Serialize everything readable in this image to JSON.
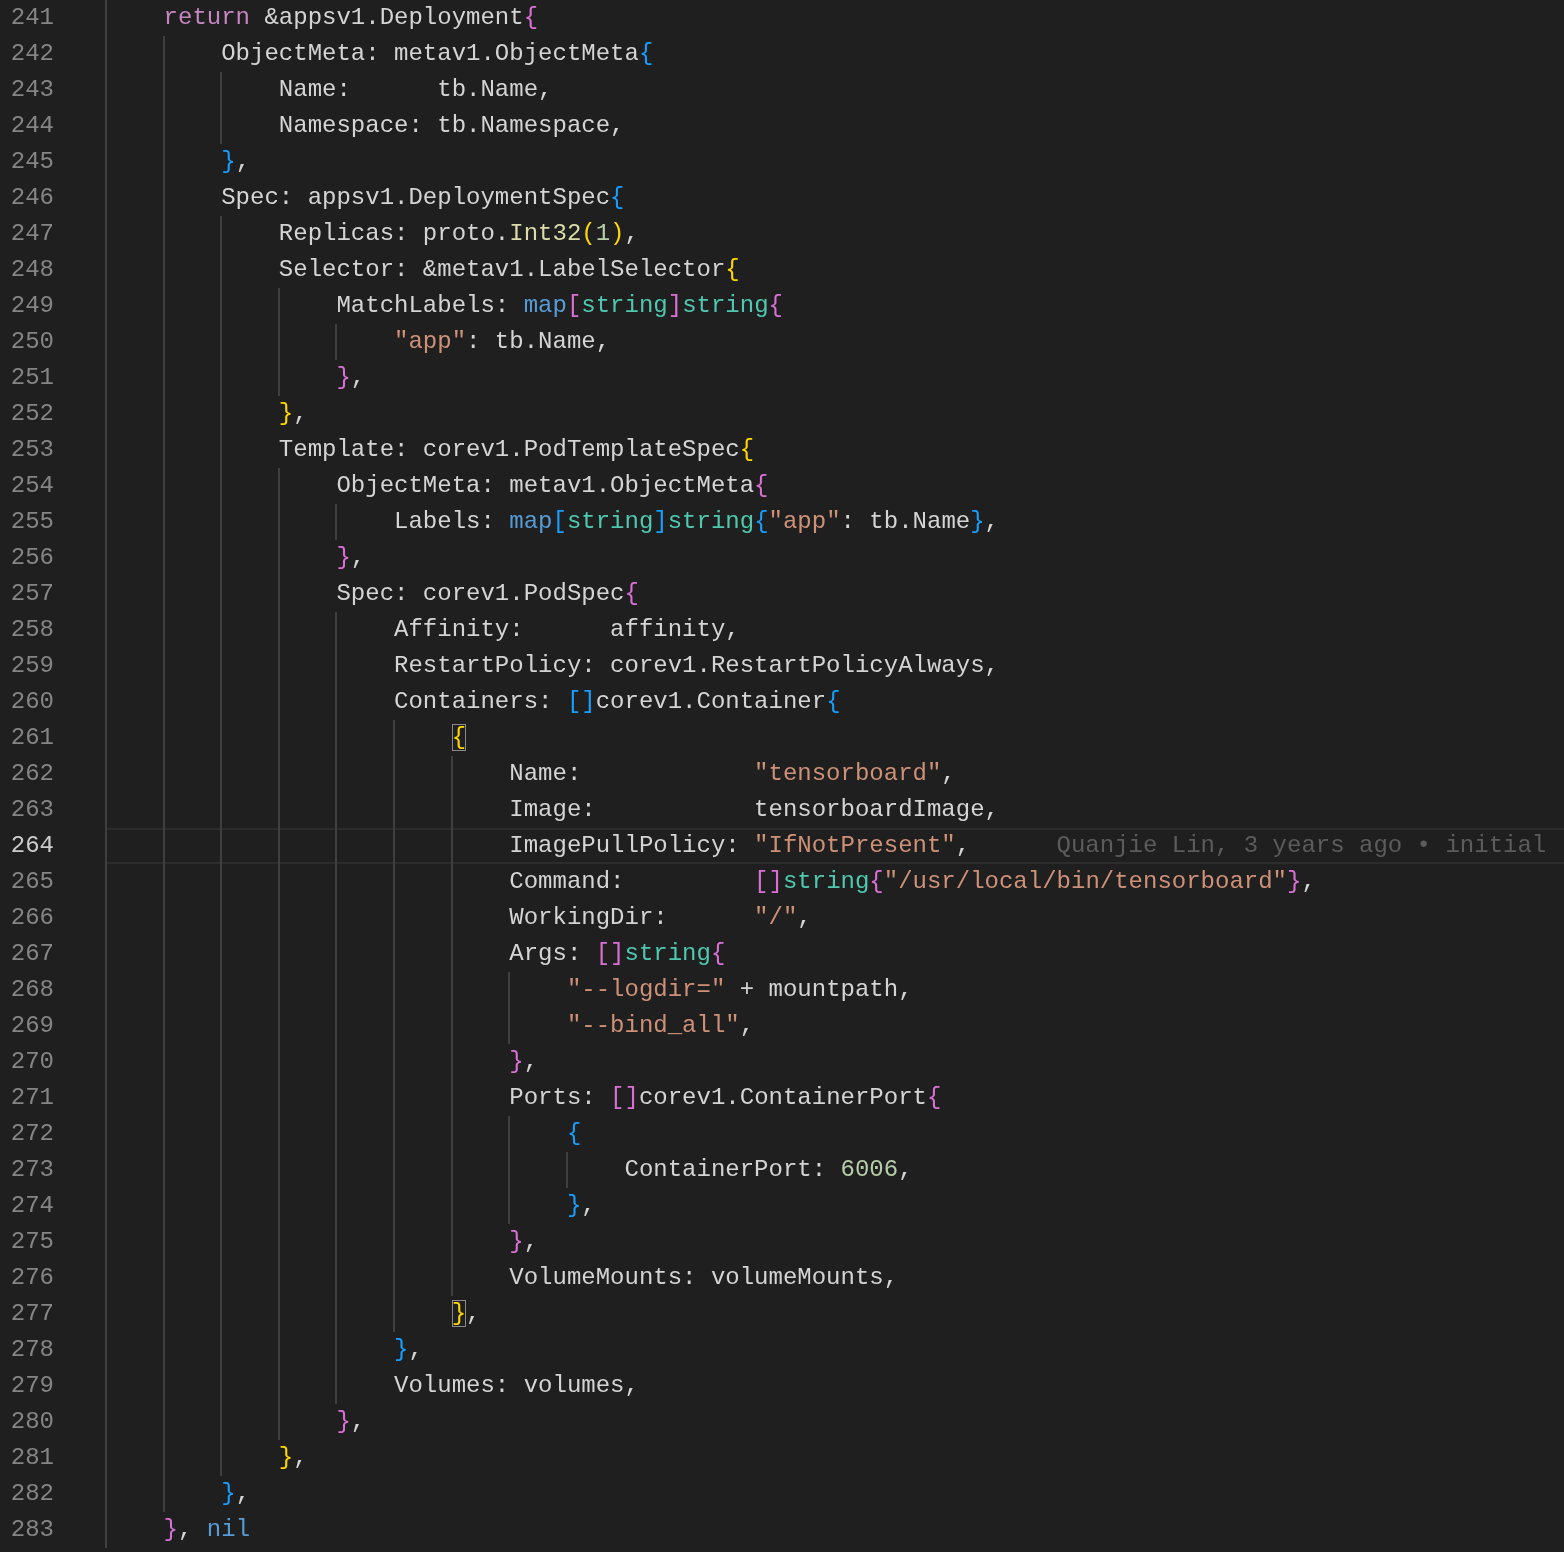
{
  "editor": {
    "lines": [
      {
        "number": "241",
        "current": false,
        "tokens": [
          {
            "kind": "keyword",
            "text": "    return"
          },
          {
            "kind": "plain",
            "text": " &appsv1.Deployment"
          },
          {
            "kind": "bracket",
            "text": "{",
            "color": "#da70d6",
            "matched": false
          }
        ]
      },
      {
        "number": "242",
        "current": false,
        "tokens": [
          {
            "kind": "plain",
            "text": "        ObjectMeta: metav1.ObjectMeta"
          },
          {
            "kind": "bracket",
            "text": "{",
            "color": "#179fff",
            "matched": false
          }
        ]
      },
      {
        "number": "243",
        "current": false,
        "tokens": [
          {
            "kind": "plain",
            "text": "            Name:      tb.Name,"
          }
        ]
      },
      {
        "number": "244",
        "current": false,
        "tokens": [
          {
            "kind": "plain",
            "text": "            Namespace: tb.Namespace,"
          }
        ]
      },
      {
        "number": "245",
        "current": false,
        "tokens": [
          {
            "kind": "bracket",
            "text": "        }",
            "color": "#179fff",
            "matched": false
          },
          {
            "kind": "plain",
            "text": ","
          }
        ]
      },
      {
        "number": "246",
        "current": false,
        "tokens": [
          {
            "kind": "plain",
            "text": "        Spec: appsv1.DeploymentSpec"
          },
          {
            "kind": "bracket",
            "text": "{",
            "color": "#179fff",
            "matched": false
          }
        ]
      },
      {
        "number": "247",
        "current": false,
        "tokens": [
          {
            "kind": "plain",
            "text": "            Replicas: proto."
          },
          {
            "kind": "function",
            "text": "Int32"
          },
          {
            "kind": "bracket",
            "text": "(",
            "color": "#ffd700",
            "matched": false
          },
          {
            "kind": "number",
            "text": "1"
          },
          {
            "kind": "bracket",
            "text": ")",
            "color": "#ffd700",
            "matched": false
          },
          {
            "kind": "plain",
            "text": ","
          }
        ]
      },
      {
        "number": "248",
        "current": false,
        "tokens": [
          {
            "kind": "plain",
            "text": "            Selector: &metav1.LabelSelector"
          },
          {
            "kind": "bracket",
            "text": "{",
            "color": "#ffd700",
            "matched": false
          }
        ]
      },
      {
        "number": "249",
        "current": false,
        "tokens": [
          {
            "kind": "plain",
            "text": "                MatchLabels: "
          },
          {
            "kind": "builtin",
            "text": "map"
          },
          {
            "kind": "bracket",
            "text": "[",
            "color": "#da70d6",
            "matched": false
          },
          {
            "kind": "type",
            "text": "string"
          },
          {
            "kind": "bracket",
            "text": "]",
            "color": "#da70d6",
            "matched": false
          },
          {
            "kind": "type",
            "text": "string"
          },
          {
            "kind": "bracket",
            "text": "{",
            "color": "#da70d6",
            "matched": false
          }
        ]
      },
      {
        "number": "250",
        "current": false,
        "tokens": [
          {
            "kind": "string",
            "text": "                    \"app\""
          },
          {
            "kind": "plain",
            "text": ": tb.Name,"
          }
        ]
      },
      {
        "number": "251",
        "current": false,
        "tokens": [
          {
            "kind": "bracket",
            "text": "                }",
            "color": "#da70d6",
            "matched": false
          },
          {
            "kind": "plain",
            "text": ","
          }
        ]
      },
      {
        "number": "252",
        "current": false,
        "tokens": [
          {
            "kind": "bracket",
            "text": "            }",
            "color": "#ffd700",
            "matched": false
          },
          {
            "kind": "plain",
            "text": ","
          }
        ]
      },
      {
        "number": "253",
        "current": false,
        "tokens": [
          {
            "kind": "plain",
            "text": "            Template: corev1.PodTemplateSpec"
          },
          {
            "kind": "bracket",
            "text": "{",
            "color": "#ffd700",
            "matched": false
          }
        ]
      },
      {
        "number": "254",
        "current": false,
        "tokens": [
          {
            "kind": "plain",
            "text": "                ObjectMeta: metav1.ObjectMeta"
          },
          {
            "kind": "bracket",
            "text": "{",
            "color": "#da70d6",
            "matched": false
          }
        ]
      },
      {
        "number": "255",
        "current": false,
        "tokens": [
          {
            "kind": "plain",
            "text": "                    Labels: "
          },
          {
            "kind": "builtin",
            "text": "map"
          },
          {
            "kind": "bracket",
            "text": "[",
            "color": "#179fff",
            "matched": false
          },
          {
            "kind": "type",
            "text": "string"
          },
          {
            "kind": "bracket",
            "text": "]",
            "color": "#179fff",
            "matched": false
          },
          {
            "kind": "type",
            "text": "string"
          },
          {
            "kind": "bracket",
            "text": "{",
            "color": "#179fff",
            "matched": false
          },
          {
            "kind": "string",
            "text": "\"app\""
          },
          {
            "kind": "plain",
            "text": ": tb.Name"
          },
          {
            "kind": "bracket",
            "text": "}",
            "color": "#179fff",
            "matched": false
          },
          {
            "kind": "plain",
            "text": ","
          }
        ]
      },
      {
        "number": "256",
        "current": false,
        "tokens": [
          {
            "kind": "bracket",
            "text": "                }",
            "color": "#da70d6",
            "matched": false
          },
          {
            "kind": "plain",
            "text": ","
          }
        ]
      },
      {
        "number": "257",
        "current": false,
        "tokens": [
          {
            "kind": "plain",
            "text": "                Spec: corev1.PodSpec"
          },
          {
            "kind": "bracket",
            "text": "{",
            "color": "#da70d6",
            "matched": false
          }
        ]
      },
      {
        "number": "258",
        "current": false,
        "tokens": [
          {
            "kind": "plain",
            "text": "                    Affinity:      affinity,"
          }
        ]
      },
      {
        "number": "259",
        "current": false,
        "tokens": [
          {
            "kind": "plain",
            "text": "                    RestartPolicy: corev1.RestartPolicyAlways,"
          }
        ]
      },
      {
        "number": "260",
        "current": false,
        "tokens": [
          {
            "kind": "plain",
            "text": "                    Containers: "
          },
          {
            "kind": "bracket",
            "text": "[",
            "color": "#179fff",
            "matched": false
          },
          {
            "kind": "bracket",
            "text": "]",
            "color": "#179fff",
            "matched": false
          },
          {
            "kind": "plain",
            "text": "corev1.Container"
          },
          {
            "kind": "bracket",
            "text": "{",
            "color": "#179fff",
            "matched": false
          }
        ]
      },
      {
        "number": "261",
        "current": false,
        "tokens": [
          {
            "kind": "bracket",
            "text": "                        {",
            "color": "#ffd700",
            "matched": true
          }
        ]
      },
      {
        "number": "262",
        "current": false,
        "tokens": [
          {
            "kind": "plain",
            "text": "                            Name:            "
          },
          {
            "kind": "string",
            "text": "\"tensorboard\""
          },
          {
            "kind": "plain",
            "text": ","
          }
        ]
      },
      {
        "number": "263",
        "current": false,
        "tokens": [
          {
            "kind": "plain",
            "text": "                            Image:           tensorboardImage,"
          }
        ]
      },
      {
        "number": "264",
        "current": true,
        "blame": "Quanjie Lin, 3 years ago • initial",
        "tokens": [
          {
            "kind": "plain",
            "text": "                            ImagePullPolicy: "
          },
          {
            "kind": "string",
            "text": "\"IfNotPresent\""
          },
          {
            "kind": "plain",
            "text": ","
          }
        ]
      },
      {
        "number": "265",
        "current": false,
        "tokens": [
          {
            "kind": "plain",
            "text": "                            Command:         "
          },
          {
            "kind": "bracket",
            "text": "[",
            "color": "#da70d6",
            "matched": false
          },
          {
            "kind": "bracket",
            "text": "]",
            "color": "#da70d6",
            "matched": false
          },
          {
            "kind": "type",
            "text": "string"
          },
          {
            "kind": "bracket",
            "text": "{",
            "color": "#da70d6",
            "matched": false
          },
          {
            "kind": "string",
            "text": "\"/usr/local/bin/tensorboard\""
          },
          {
            "kind": "bracket",
            "text": "}",
            "color": "#da70d6",
            "matched": false
          },
          {
            "kind": "plain",
            "text": ","
          }
        ]
      },
      {
        "number": "266",
        "current": false,
        "tokens": [
          {
            "kind": "plain",
            "text": "                            WorkingDir:      "
          },
          {
            "kind": "string",
            "text": "\"/\""
          },
          {
            "kind": "plain",
            "text": ","
          }
        ]
      },
      {
        "number": "267",
        "current": false,
        "tokens": [
          {
            "kind": "plain",
            "text": "                            Args: "
          },
          {
            "kind": "bracket",
            "text": "[",
            "color": "#da70d6",
            "matched": false
          },
          {
            "kind": "bracket",
            "text": "]",
            "color": "#da70d6",
            "matched": false
          },
          {
            "kind": "type",
            "text": "string"
          },
          {
            "kind": "bracket",
            "text": "{",
            "color": "#da70d6",
            "matched": false
          }
        ]
      },
      {
        "number": "268",
        "current": false,
        "tokens": [
          {
            "kind": "string",
            "text": "                                \"--logdir=\""
          },
          {
            "kind": "plain",
            "text": " + mountpath,"
          }
        ]
      },
      {
        "number": "269",
        "current": false,
        "tokens": [
          {
            "kind": "string",
            "text": "                                \"--bind_all\""
          },
          {
            "kind": "plain",
            "text": ","
          }
        ]
      },
      {
        "number": "270",
        "current": false,
        "tokens": [
          {
            "kind": "bracket",
            "text": "                            }",
            "color": "#da70d6",
            "matched": false
          },
          {
            "kind": "plain",
            "text": ","
          }
        ]
      },
      {
        "number": "271",
        "current": false,
        "tokens": [
          {
            "kind": "plain",
            "text": "                            Ports: "
          },
          {
            "kind": "bracket",
            "text": "[",
            "color": "#da70d6",
            "matched": false
          },
          {
            "kind": "bracket",
            "text": "]",
            "color": "#da70d6",
            "matched": false
          },
          {
            "kind": "plain",
            "text": "corev1.ContainerPort"
          },
          {
            "kind": "bracket",
            "text": "{",
            "color": "#da70d6",
            "matched": false
          }
        ]
      },
      {
        "number": "272",
        "current": false,
        "tokens": [
          {
            "kind": "bracket",
            "text": "                                {",
            "color": "#179fff",
            "matched": false
          }
        ]
      },
      {
        "number": "273",
        "current": false,
        "tokens": [
          {
            "kind": "plain",
            "text": "                                    ContainerPort: "
          },
          {
            "kind": "number",
            "text": "6006"
          },
          {
            "kind": "plain",
            "text": ","
          }
        ]
      },
      {
        "number": "274",
        "current": false,
        "tokens": [
          {
            "kind": "bracket",
            "text": "                                }",
            "color": "#179fff",
            "matched": false
          },
          {
            "kind": "plain",
            "text": ","
          }
        ]
      },
      {
        "number": "275",
        "current": false,
        "tokens": [
          {
            "kind": "bracket",
            "text": "                            }",
            "color": "#da70d6",
            "matched": false
          },
          {
            "kind": "plain",
            "text": ","
          }
        ]
      },
      {
        "number": "276",
        "current": false,
        "tokens": [
          {
            "kind": "plain",
            "text": "                            VolumeMounts: volumeMounts,"
          }
        ]
      },
      {
        "number": "277",
        "current": false,
        "tokens": [
          {
            "kind": "bracket",
            "text": "                        }",
            "color": "#ffd700",
            "matched": true
          },
          {
            "kind": "plain",
            "text": ","
          }
        ]
      },
      {
        "number": "278",
        "current": false,
        "tokens": [
          {
            "kind": "bracket",
            "text": "                    }",
            "color": "#179fff",
            "matched": false
          },
          {
            "kind": "plain",
            "text": ","
          }
        ]
      },
      {
        "number": "279",
        "current": false,
        "tokens": [
          {
            "kind": "plain",
            "text": "                    Volumes: volumes,"
          }
        ]
      },
      {
        "number": "280",
        "current": false,
        "tokens": [
          {
            "kind": "bracket",
            "text": "                }",
            "color": "#da70d6",
            "matched": false
          },
          {
            "kind": "plain",
            "text": ","
          }
        ]
      },
      {
        "number": "281",
        "current": false,
        "tokens": [
          {
            "kind": "bracket",
            "text": "            }",
            "color": "#ffd700",
            "matched": false
          },
          {
            "kind": "plain",
            "text": ","
          }
        ]
      },
      {
        "number": "282",
        "current": false,
        "tokens": [
          {
            "kind": "bracket",
            "text": "        }",
            "color": "#179fff",
            "matched": false
          },
          {
            "kind": "plain",
            "text": ","
          }
        ]
      },
      {
        "number": "283",
        "current": false,
        "tokens": [
          {
            "kind": "bracket",
            "text": "    }",
            "color": "#da70d6",
            "matched": false
          },
          {
            "kind": "plain",
            "text": ", "
          },
          {
            "kind": "builtin",
            "text": "nil"
          }
        ]
      }
    ]
  }
}
